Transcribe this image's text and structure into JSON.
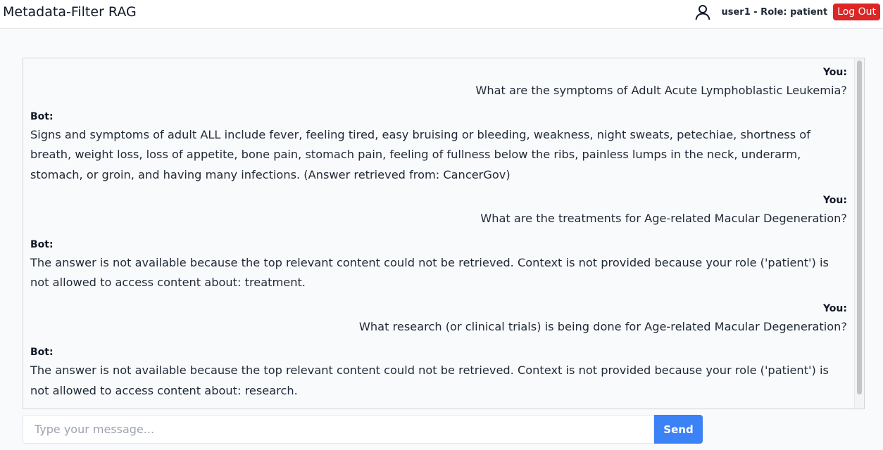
{
  "header": {
    "title": "Metadata-Filter RAG",
    "user_label": "user1 - Role: patient",
    "logout_label": "Log Out",
    "user_icon": "user-icon"
  },
  "chat": {
    "messages": [
      {
        "speaker": "You:",
        "text": "What are the symptoms of Adult Acute Lymphoblastic Leukemia?"
      },
      {
        "speaker": "Bot:",
        "text": "Signs and symptoms of adult ALL include fever, feeling tired, easy bruising or bleeding, weakness, night sweats, petechiae, shortness of breath, weight loss, loss of appetite, bone pain, stomach pain, feeling of fullness below the ribs, painless lumps in the neck, underarm, stomach, or groin, and having many infections. (Answer retrieved from: CancerGov)"
      },
      {
        "speaker": "You:",
        "text": "What are the treatments for Age-related Macular Degeneration?"
      },
      {
        "speaker": "Bot:",
        "text": "The answer is not available because the top relevant content could not be retrieved. Context is not provided because your role ('patient') is not allowed to access content about: treatment."
      },
      {
        "speaker": "You:",
        "text": "What research (or clinical trials) is being done for Age-related Macular Degeneration?"
      },
      {
        "speaker": "Bot:",
        "text": "The answer is not available because the top relevant content could not be retrieved. Context is not provided because your role ('patient') is not allowed to access content about: research."
      }
    ]
  },
  "composer": {
    "placeholder": "Type your message...",
    "value": "",
    "send_label": "Send"
  },
  "colors": {
    "logout": "#dc2626",
    "send": "#3b82f6"
  }
}
